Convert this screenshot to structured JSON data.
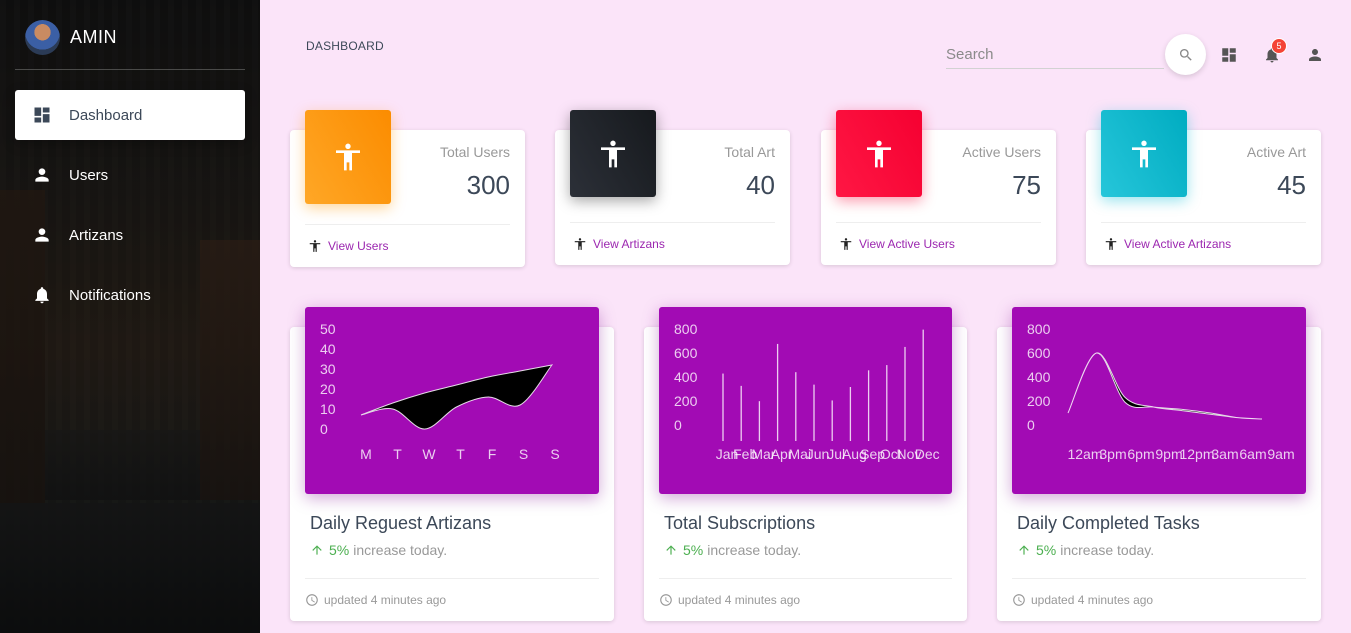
{
  "sidebar": {
    "brand_name": "AMIN",
    "items": [
      {
        "label": "Dashboard",
        "icon": "dashboard-icon",
        "active": true
      },
      {
        "label": "Users",
        "icon": "person-icon"
      },
      {
        "label": "Artizans",
        "icon": "person-icon"
      },
      {
        "label": "Notifications",
        "icon": "bell-icon"
      }
    ]
  },
  "header": {
    "breadcrumb": "DASHBOARD",
    "search_placeholder": "Search",
    "notification_count": "5"
  },
  "stats": [
    {
      "title": "Total Users",
      "value": "300",
      "link": "View Users",
      "color": "#ff9800"
    },
    {
      "title": "Total Art",
      "value": "40",
      "link": "View Artizans",
      "color": "#222831"
    },
    {
      "title": "Active Users",
      "value": "75",
      "link": "View Active Users",
      "color": "#fc0a3a"
    },
    {
      "title": "Active Art",
      "value": "45",
      "link": "View Active Artizans",
      "color": "#00bcd4"
    }
  ],
  "charts": [
    {
      "title": "Daily Reguest Artizans",
      "percent": "5%",
      "increase_text": "increase today.",
      "updated": "updated 4 minutes ago"
    },
    {
      "title": "Total Subscriptions",
      "percent": "5%",
      "increase_text": "increase today.",
      "updated": "updated 4 minutes ago"
    },
    {
      "title": "Daily Completed Tasks",
      "percent": "5%",
      "increase_text": "increase today.",
      "updated": "updated 4 minutes ago"
    }
  ],
  "colors": {
    "chart_bg": "#a20bb4",
    "link": "#9c27b0",
    "success": "#4caf50",
    "page_bg": "#fbe4f9"
  },
  "chart_data": [
    {
      "type": "area",
      "categories": [
        "M",
        "T",
        "W",
        "T",
        "F",
        "S",
        "S"
      ],
      "y_ticks": [
        "50",
        "40",
        "30",
        "20",
        "10",
        "0"
      ],
      "ylim": [
        0,
        50
      ],
      "series": [
        {
          "values": [
            7,
            10,
            0,
            11,
            16,
            12,
            32
          ]
        },
        {
          "values": [
            7,
            13,
            18,
            22,
            26,
            29,
            32
          ]
        }
      ]
    },
    {
      "type": "bar",
      "categories": [
        "Jan",
        "Feb",
        "Mar",
        "Apr",
        "Mai",
        "Jun",
        "Jul",
        "Aug",
        "Sep",
        "Oct",
        "Nov",
        "Dec"
      ],
      "y_ticks": [
        "800",
        "600",
        "400",
        "200",
        "0"
      ],
      "ylim": [
        0,
        800
      ],
      "values": [
        542,
        443,
        320,
        780,
        553,
        453,
        326,
        434,
        568,
        610,
        756,
        895
      ]
    },
    {
      "type": "area",
      "categories": [
        "12am",
        "3pm",
        "6pm",
        "9pm",
        "12pm",
        "3am",
        "6am",
        "9am"
      ],
      "y_ticks": [
        "800",
        "600",
        "400",
        "200",
        "0"
      ],
      "ylim": [
        0,
        800
      ],
      "series": [
        {
          "values": [
            100,
            600,
            190,
            150,
            130,
            100,
            60,
            50
          ]
        },
        {
          "values": [
            100,
            600,
            230,
            150,
            120,
            90,
            60,
            50
          ]
        }
      ]
    }
  ]
}
